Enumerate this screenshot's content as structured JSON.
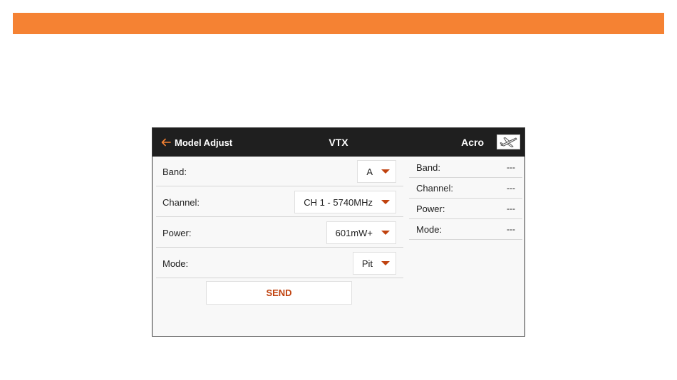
{
  "header": {
    "back_label": "Model Adjust",
    "title": "VTX",
    "model_name": "Acro",
    "model_icon": "airplane-icon"
  },
  "settings": [
    {
      "label": "Band:",
      "value": "A"
    },
    {
      "label": "Channel:",
      "value": "CH 1 - 5740MHz"
    },
    {
      "label": "Power:",
      "value": "601mW+"
    },
    {
      "label": "Mode:",
      "value": "Pit"
    }
  ],
  "send_label": "SEND",
  "status": [
    {
      "label": "Band:",
      "value": "---"
    },
    {
      "label": "Channel:",
      "value": "---"
    },
    {
      "label": "Power:",
      "value": "---"
    },
    {
      "label": "Mode:",
      "value": "---"
    }
  ],
  "colors": {
    "banner": "#f58233",
    "header_bg": "#1f1f1f",
    "accent": "#c0420f",
    "back_arrow": "#f58233"
  }
}
